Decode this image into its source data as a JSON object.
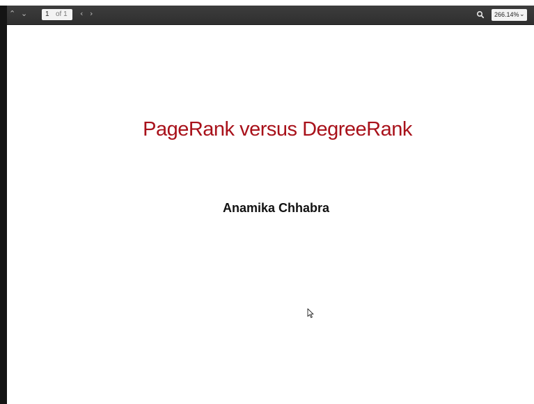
{
  "toolbar": {
    "prev_icon": "chevron-up-icon",
    "next_icon": "chevron-down-icon",
    "page_current": "1",
    "page_total": "of 1",
    "back_icon": "chevron-left-icon",
    "forward_icon": "chevron-right-icon",
    "search_icon": "search-icon",
    "zoom_value": "266.14%",
    "zoom_dropdown_icon": "chevron-down-icon"
  },
  "slide": {
    "title": "PageRank versus DegreeRank",
    "author": "Anamika Chhabra"
  },
  "colors": {
    "toolbar_bg": "#353535",
    "title": "#a8111a",
    "author": "#111111",
    "page_bg": "#ffffff"
  }
}
